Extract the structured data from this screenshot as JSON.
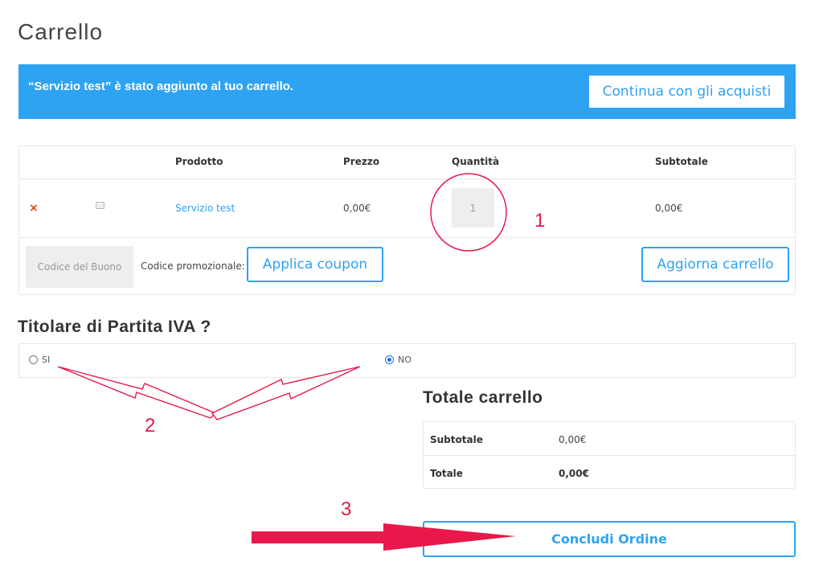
{
  "page": {
    "title": "Carrello"
  },
  "notice": {
    "message": "“Servizio test” è stato aggiunto al tuo carrello.",
    "continue_label": "Continua con gli acquisti",
    "color": "#2ea3f2"
  },
  "cart": {
    "headers": {
      "product": "Prodotto",
      "price": "Prezzo",
      "quantity": "Quantità",
      "subtotal": "Subtotale"
    },
    "rows": [
      {
        "product": "Servizio test",
        "price": "0,00€",
        "quantity": "1",
        "subtotal": "0,00€",
        "remove_icon": "close-icon",
        "thumb_icon": "image-placeholder-icon"
      }
    ],
    "coupon_placeholder": "Codice del Buono",
    "coupon_label": "Codice promozionale:",
    "apply_label": "Applica coupon",
    "update_label": "Aggiorna carrello"
  },
  "vat": {
    "title": "Titolare di Partita IVA ?",
    "options": [
      {
        "label": "SI",
        "checked": false
      },
      {
        "label": "NO",
        "checked": true
      }
    ]
  },
  "totals": {
    "title": "Totale carrello",
    "subtotal_label": "Subtotale",
    "subtotal_value": "0,00€",
    "total_label": "Totale",
    "total_value": "0,00€"
  },
  "checkout": {
    "label": "Concludi Ordine"
  },
  "annotations": {
    "one": "1",
    "two": "2",
    "three": "3",
    "color": "#e8194a"
  }
}
